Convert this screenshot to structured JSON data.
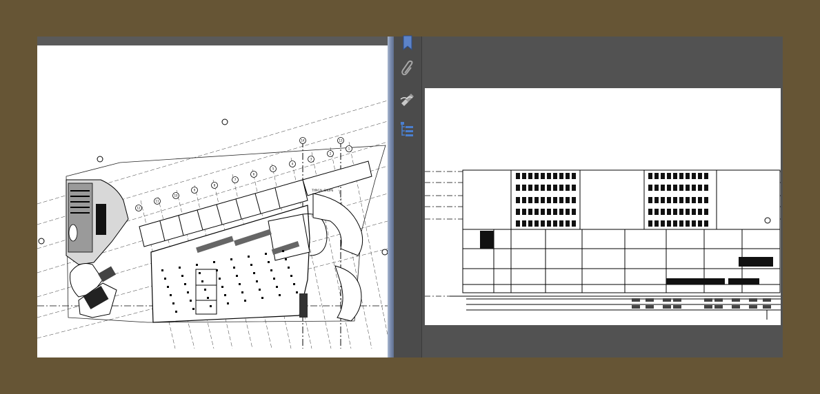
{
  "app": {
    "name": "PDF viewer"
  },
  "left_document": {
    "kind": "floor-plan",
    "grid_bubbles": [
      "14",
      "13",
      "3",
      "2",
      "1",
      "4",
      "5",
      "6",
      "7",
      "8",
      "9",
      "10",
      "11",
      "12"
    ],
    "labels": [
      "TYPICAL SHOPS"
    ]
  },
  "right_document": {
    "kind": "building-elevation"
  },
  "icons": {
    "bookmark": "bookmark-icon",
    "attachment": "paperclip-icon",
    "signature": "signature-pen-icon",
    "layers": "layers-tree-icon"
  },
  "colors": {
    "background": "#665535",
    "panel": "#525252",
    "rail": "#4b4b4b",
    "icon_blue": "#3e6fc2",
    "page": "#ffffff"
  }
}
